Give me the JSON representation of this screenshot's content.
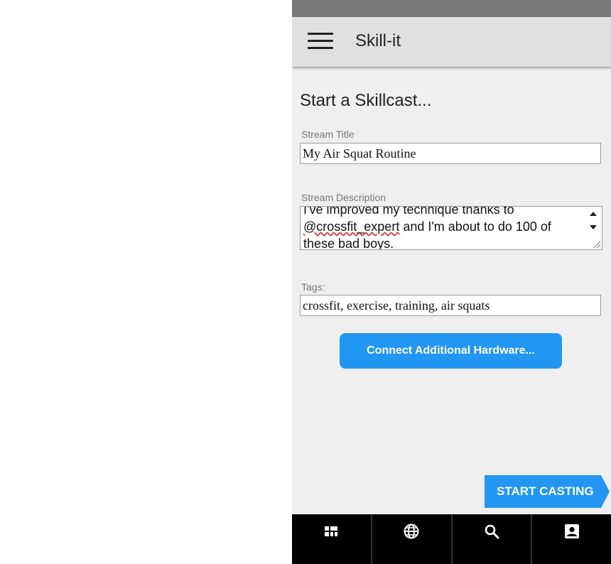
{
  "app": {
    "title": "Skill-it"
  },
  "page": {
    "title": "Start a Skillcast..."
  },
  "form": {
    "stream_title": {
      "label": "Stream Title",
      "value": "My Air Squat Routine"
    },
    "stream_description": {
      "label": "Stream Description",
      "lines": [
        "I've improved my technique thanks to",
        "@crossfit_expert and I'm about to do 100 of",
        "these bad boys."
      ],
      "mention": "@crossfit_expert",
      "mention_rest": " and I'm about to do 100 of"
    },
    "tags": {
      "label": "Tags:",
      "value": "crossfit, exercise, training, air squats"
    }
  },
  "buttons": {
    "connect_hardware": "Connect Additional Hardware...",
    "start_casting": "START CASTING"
  },
  "bottom_nav": {
    "items": [
      {
        "icon": "dashboard-icon"
      },
      {
        "icon": "globe-icon"
      },
      {
        "icon": "search-icon"
      },
      {
        "icon": "profile-icon"
      }
    ]
  },
  "colors": {
    "accent": "#2196f3",
    "appbar": "#e0e0e0",
    "background": "#efefef",
    "statusbar": "#7a7a7a",
    "nav": "#000000"
  }
}
